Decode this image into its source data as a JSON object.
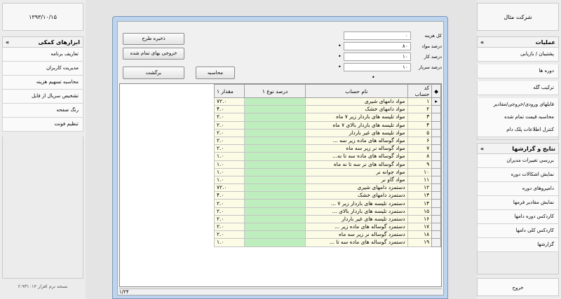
{
  "date": "۱۳۹۳/۱۰/۱۵",
  "company": "شرکت مثال",
  "version": "نسخه نرم افزار ۲.۹۳۱۰۱۴",
  "left_panel": {
    "title": "ابزارهای کمکی",
    "items": [
      "تعاریف برنامه",
      "مدیریت کاربران",
      "محاسبه تسهیم هزینه",
      "تشخیص سریال از فایل",
      "رنگ صفحه",
      "تنظیم فونت"
    ]
  },
  "right_panels": [
    {
      "title": "عملیات",
      "items": [
        "پشتیبان / بازیابی",
        "دوره ها",
        "ترکیب گله",
        "فایلهای ورودی/خروجی/مقادیر",
        "محاسبه قیمت تمام شده",
        "کنترل اطلاعات پلک دام"
      ]
    },
    {
      "title": "نتایج و گزارشها",
      "items": [
        "بررسی تغییرات مدیران",
        "نمایش اشکالات دوره",
        "دامپروهای دوره",
        "نمایش مقادیر فرمها",
        "کاردکس دوره دامها",
        "کاردکس کلی دامها",
        "گزارشها"
      ]
    }
  ],
  "exit_label": "خروج",
  "buttons": {
    "save_design": "ذخیره طرح",
    "export_cost": "خروجی بهای تمام شده",
    "back": "برگشت",
    "calculate": "محاسبه"
  },
  "fields": [
    {
      "label": "کل هزینه",
      "value": "۰"
    },
    {
      "label": "درصد مواد",
      "value": "۸۰"
    },
    {
      "label": "درصد کار",
      "value": "۱۰"
    },
    {
      "label": "درصد سربار",
      "value": "۱۰"
    }
  ],
  "columns": {
    "code": "کد حساب",
    "name": "نام حساب",
    "pct": "درصد نوع ۱",
    "qty": "مقدار ۱"
  },
  "rows": [
    {
      "code": "۱",
      "name": "مواد دامهای شیری",
      "pct": "",
      "qty": "۷۲.۰"
    },
    {
      "code": "۲",
      "name": "مواد دامهای خشک",
      "pct": "",
      "qty": "۴.۰"
    },
    {
      "code": "۳",
      "name": "مواد تلیسه های باردار زیر ۷ ماه",
      "pct": "",
      "qty": "۲.۰"
    },
    {
      "code": "۴",
      "name": "مواد تلیسه های باردار بالای ۷ ماه",
      "pct": "",
      "qty": "۲.۰"
    },
    {
      "code": "۵",
      "name": "مواد تلیسه های غیر باردار",
      "pct": "",
      "qty": "۲.۰"
    },
    {
      "code": "۶",
      "name": "مواد گوساله های ماده زیر سه ...",
      "pct": "",
      "qty": "۲.۰"
    },
    {
      "code": "۷",
      "name": "مواد گوساله نر زیر سه ماه",
      "pct": "",
      "qty": "۲.۰"
    },
    {
      "code": "۸",
      "name": "مواد گوساله های ماده سه تا نه...",
      "pct": "",
      "qty": "۱.۰"
    },
    {
      "code": "۹",
      "name": "مواد گوساله های نر سه تا نه ماه",
      "pct": "",
      "qty": "۱.۰"
    },
    {
      "code": "۱۰",
      "name": "مواد جوانه نر",
      "pct": "",
      "qty": "۱.۰"
    },
    {
      "code": "۱۱",
      "name": "مواد گاو نر",
      "pct": "",
      "qty": "۱.۰"
    },
    {
      "code": "۱۲",
      "name": "دستمزد دامهای شیری",
      "pct": "",
      "qty": "۷۲.۰"
    },
    {
      "code": "۱۳",
      "name": "دستمزد دامهای خشک",
      "pct": "",
      "qty": "۴.۰"
    },
    {
      "code": "۱۴",
      "name": "دستمزد تلیسه های باردار زیر ۷ ...",
      "pct": "",
      "qty": "۲.۰"
    },
    {
      "code": "۱۵",
      "name": "دستمزد تلیسه های باردار بالای ...",
      "pct": "",
      "qty": "۲.۰"
    },
    {
      "code": "۱۶",
      "name": "دستمزد تلیسه های غیر باردار",
      "pct": "",
      "qty": "۲.۰"
    },
    {
      "code": "۱۷",
      "name": "دستمزد گوساله های ماده زیر ...",
      "pct": "",
      "qty": "۲.۰"
    },
    {
      "code": "۱۸",
      "name": "دستمزد گوساله نر زیر سه ماه",
      "pct": "",
      "qty": "۲.۰"
    },
    {
      "code": "۱۹",
      "name": "دستمزد گوساله های ماده سه تا ...",
      "pct": "",
      "qty": "۱.۰"
    }
  ],
  "status": "۱/۲۴",
  "colors": {
    "pct_cell": "#bfeebe",
    "cell": "#fbfbe6",
    "window_frame": "#bcd4ee"
  }
}
